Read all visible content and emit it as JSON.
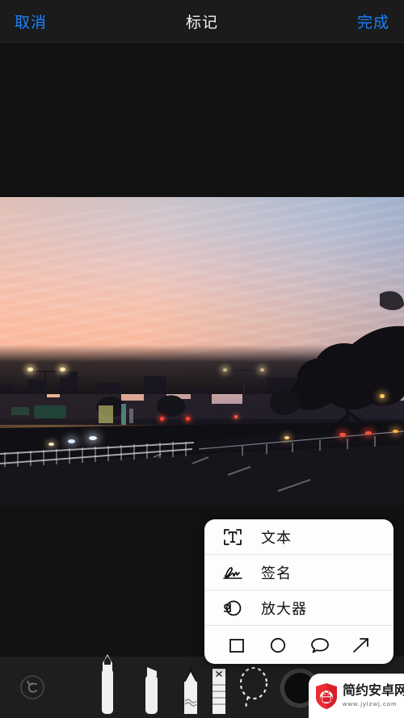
{
  "header": {
    "cancel_label": "取消",
    "title": "标记",
    "done_label": "完成",
    "accent_color": "#1982ff",
    "title_color": "#f2f2f2",
    "background_color": "#1b1b1b"
  },
  "canvas": {
    "background_color": "#121212",
    "photo_description": "城市傍晚街道日落照片"
  },
  "popup_menu": {
    "items": [
      {
        "icon": "text-box-icon",
        "label": "文本"
      },
      {
        "icon": "signature-icon",
        "label": "签名"
      },
      {
        "icon": "magnifier-icon",
        "label": "放大器"
      }
    ],
    "shapes": [
      {
        "icon": "square-shape-icon",
        "name": "square"
      },
      {
        "icon": "circle-shape-icon",
        "name": "circle"
      },
      {
        "icon": "speech-bubble-shape-icon",
        "name": "speech-bubble"
      },
      {
        "icon": "arrow-shape-icon",
        "name": "arrow"
      }
    ],
    "background_color": "#fdfdfd"
  },
  "toolbar": {
    "background_color": "#1e1e1e",
    "undo_icon": "undo-icon",
    "tools": [
      {
        "name": "pen",
        "icon": "pen-tool-icon",
        "selected": true
      },
      {
        "name": "marker",
        "icon": "marker-tool-icon",
        "selected": false
      },
      {
        "name": "pencil",
        "icon": "pencil-tool-icon",
        "selected": false
      },
      {
        "name": "eraser",
        "icon": "eraser-tool-icon",
        "selected": false
      },
      {
        "name": "lasso",
        "icon": "lasso-tool-icon",
        "selected": false
      }
    ],
    "color_swatch": "#0c0c0c"
  },
  "watermark": {
    "title": "简约安卓网",
    "url": "www.jylzwj.com",
    "logo_color": "#d8202a",
    "logo_icon": "android-shield-logo"
  }
}
